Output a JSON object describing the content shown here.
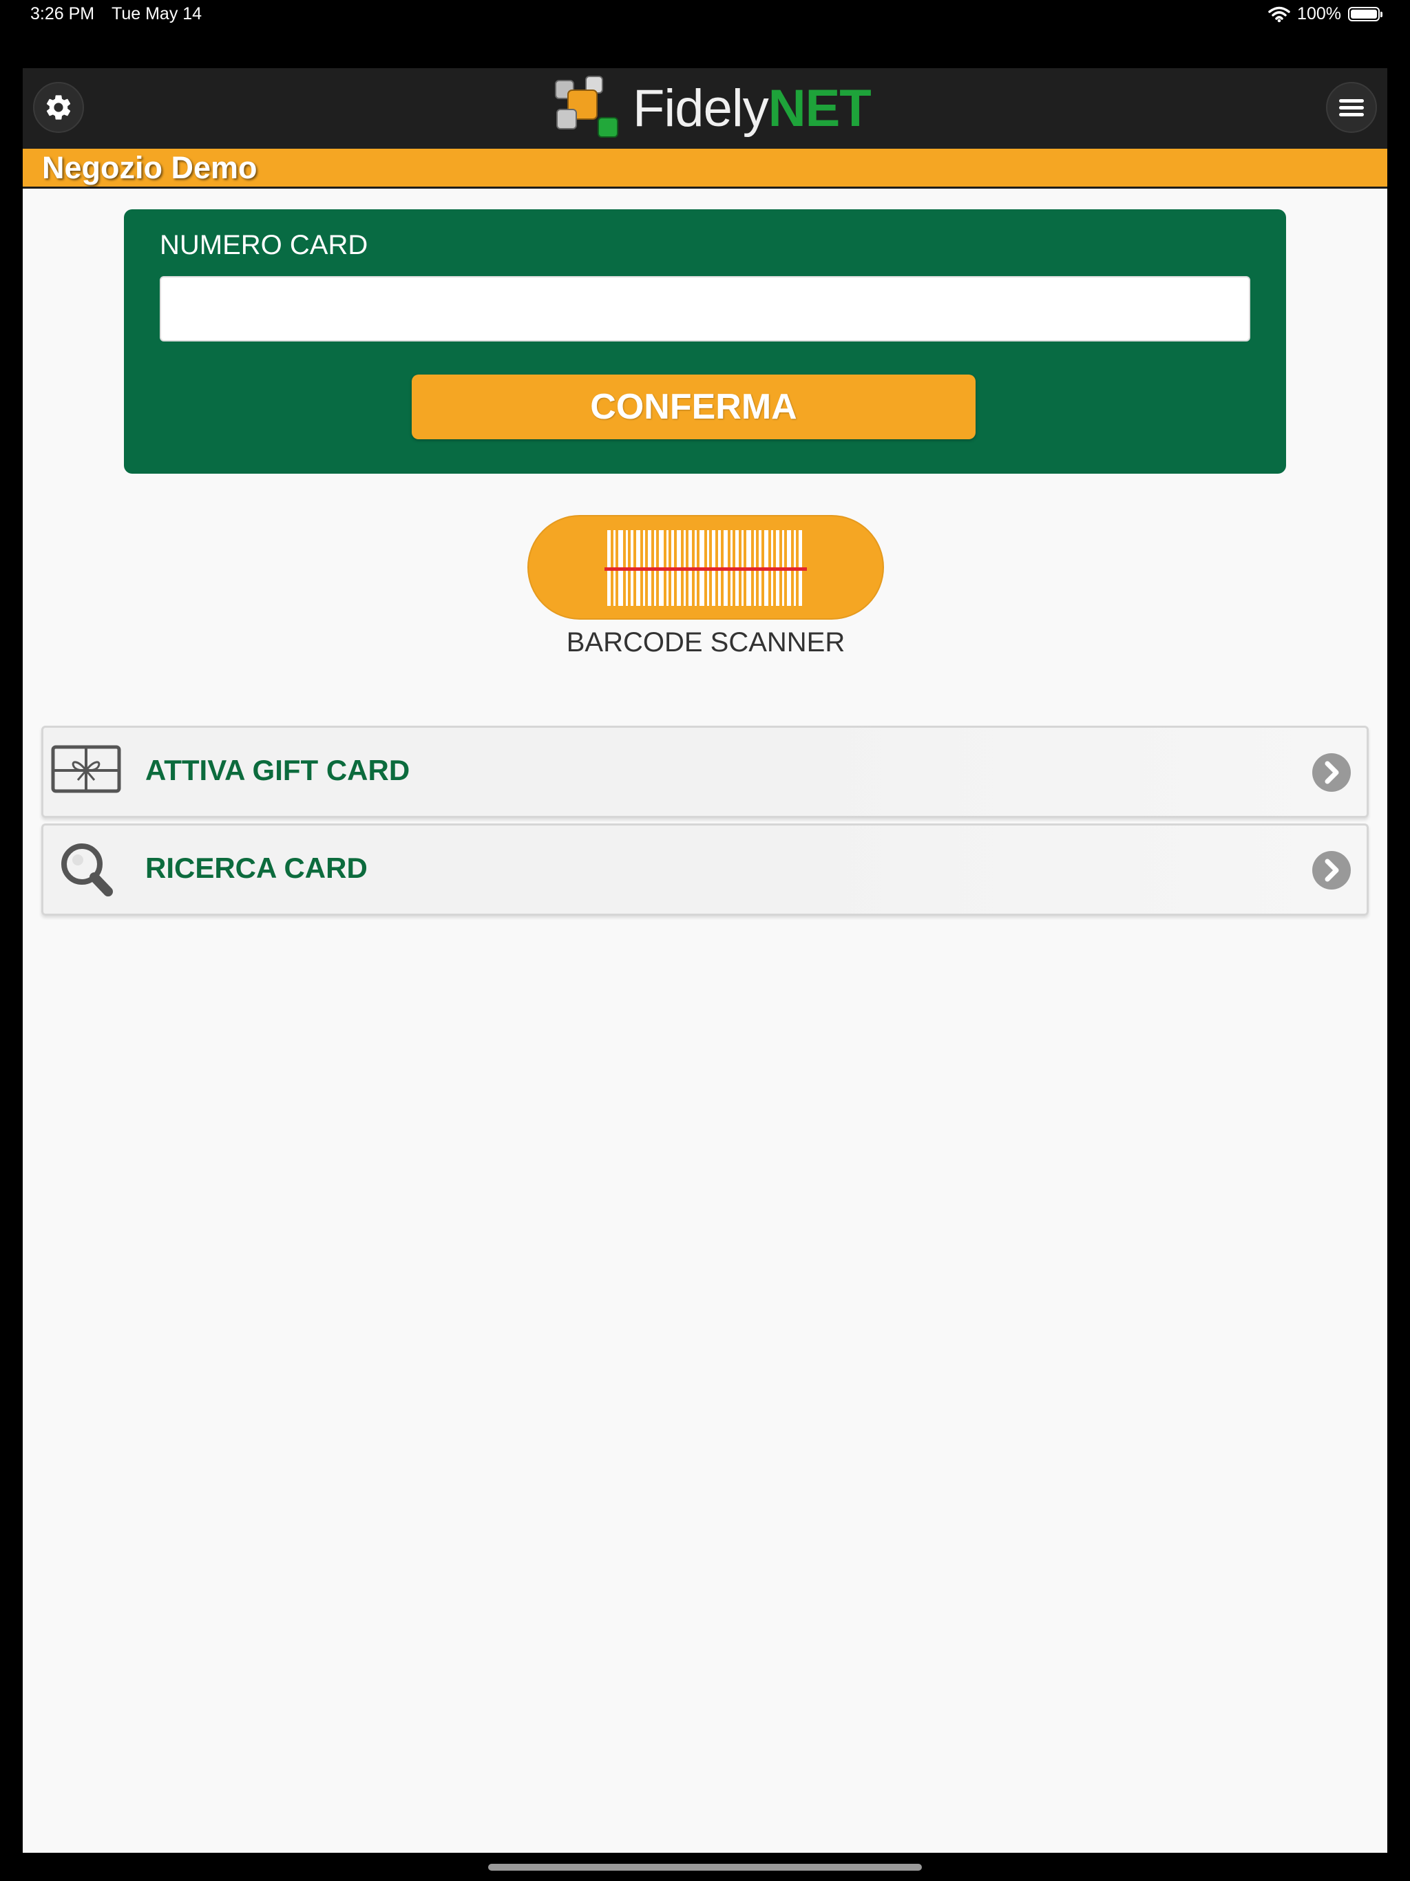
{
  "status_bar": {
    "time": "3:26 PM",
    "date": "Tue May 14",
    "battery": "100%"
  },
  "header": {
    "logo_text_a": "Fidely",
    "logo_text_b": "NET",
    "settings_icon": "gear-icon",
    "menu_icon": "hamburger-menu-icon"
  },
  "store": {
    "name": "Negozio Demo"
  },
  "card_form": {
    "label": "NUMERO CARD",
    "input_value": "",
    "input_placeholder": "",
    "confirm_label": "CONFERMA"
  },
  "scanner": {
    "label": "BARCODE SCANNER",
    "icon": "barcode-icon"
  },
  "menu_items": [
    {
      "label": "ATTIVA GIFT CARD",
      "icon": "gift-card-icon"
    },
    {
      "label": "RICERCA CARD",
      "icon": "magnifier-icon"
    }
  ],
  "colors": {
    "orange": "#f5a623",
    "green": "#086b43",
    "header": "#1f1f1f",
    "label_green": "#0c6b3d"
  }
}
